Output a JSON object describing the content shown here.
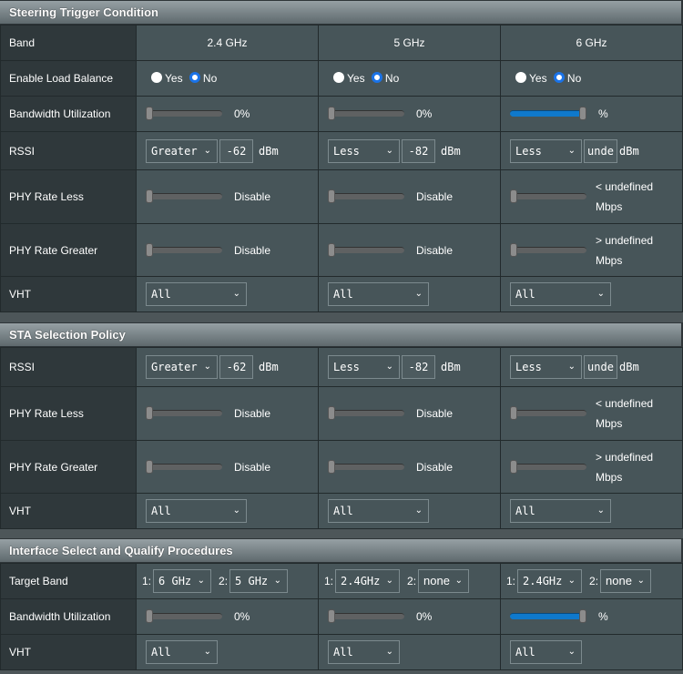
{
  "colors": {
    "accent": "#1a73e8",
    "slider_fill": "#0f79cc",
    "label_bg": "#2f383b",
    "value_bg": "#475559"
  },
  "steering": {
    "title": "Steering Trigger Condition",
    "band": {
      "label": "Band",
      "values": [
        "2.4 GHz",
        "5 GHz",
        "6 GHz"
      ]
    },
    "load_balance": {
      "label": "Enable Load Balance",
      "yes": "Yes",
      "no": "No",
      "selected": [
        "No",
        "No",
        "No"
      ]
    },
    "bandwidth": {
      "label": "Bandwidth Utilization",
      "values": [
        "0%",
        "0%",
        "%"
      ],
      "levels": [
        0,
        0,
        100
      ]
    },
    "rssi": {
      "label": "RSSI",
      "ops": [
        "Greater",
        "Less",
        "Less"
      ],
      "values": [
        "-62",
        "-82",
        "unde"
      ],
      "unit": "dBm"
    },
    "phy_less": {
      "label": "PHY Rate Less",
      "levels": [
        0,
        0,
        0
      ],
      "texts": [
        "Disable",
        "Disable",
        "< undefined"
      ],
      "unit": "Mbps"
    },
    "phy_greater": {
      "label": "PHY Rate Greater",
      "levels": [
        0,
        0,
        0
      ],
      "texts": [
        "Disable",
        "Disable",
        "> undefined"
      ],
      "unit": "Mbps"
    },
    "vht": {
      "label": "VHT",
      "values": [
        "All",
        "All",
        "All"
      ]
    }
  },
  "sta": {
    "title": "STA Selection Policy",
    "rssi": {
      "label": "RSSI",
      "ops": [
        "Greater",
        "Less",
        "Less"
      ],
      "values": [
        "-62",
        "-82",
        "unde"
      ],
      "unit": "dBm"
    },
    "phy_less": {
      "label": "PHY Rate Less",
      "levels": [
        0,
        0,
        0
      ],
      "texts": [
        "Disable",
        "Disable",
        "< undefined"
      ],
      "unit": "Mbps"
    },
    "phy_greater": {
      "label": "PHY Rate Greater",
      "levels": [
        0,
        0,
        0
      ],
      "texts": [
        "Disable",
        "Disable",
        "> undefined"
      ],
      "unit": "Mbps"
    },
    "vht": {
      "label": "VHT",
      "values": [
        "All",
        "All",
        "All"
      ]
    }
  },
  "iface": {
    "title": "Interface Select and Qualify Procedures",
    "target": {
      "label": "Target Band",
      "p1": "1:",
      "p2": "2:",
      "first": [
        "6 GHz",
        "2.4GHz",
        "2.4GHz"
      ],
      "second": [
        "5 GHz",
        "none",
        "none"
      ]
    },
    "bandwidth": {
      "label": "Bandwidth Utilization",
      "values": [
        "0%",
        "0%",
        "%"
      ],
      "levels": [
        0,
        0,
        100
      ]
    },
    "vht": {
      "label": "VHT",
      "values": [
        "All",
        "All",
        "All"
      ]
    }
  }
}
